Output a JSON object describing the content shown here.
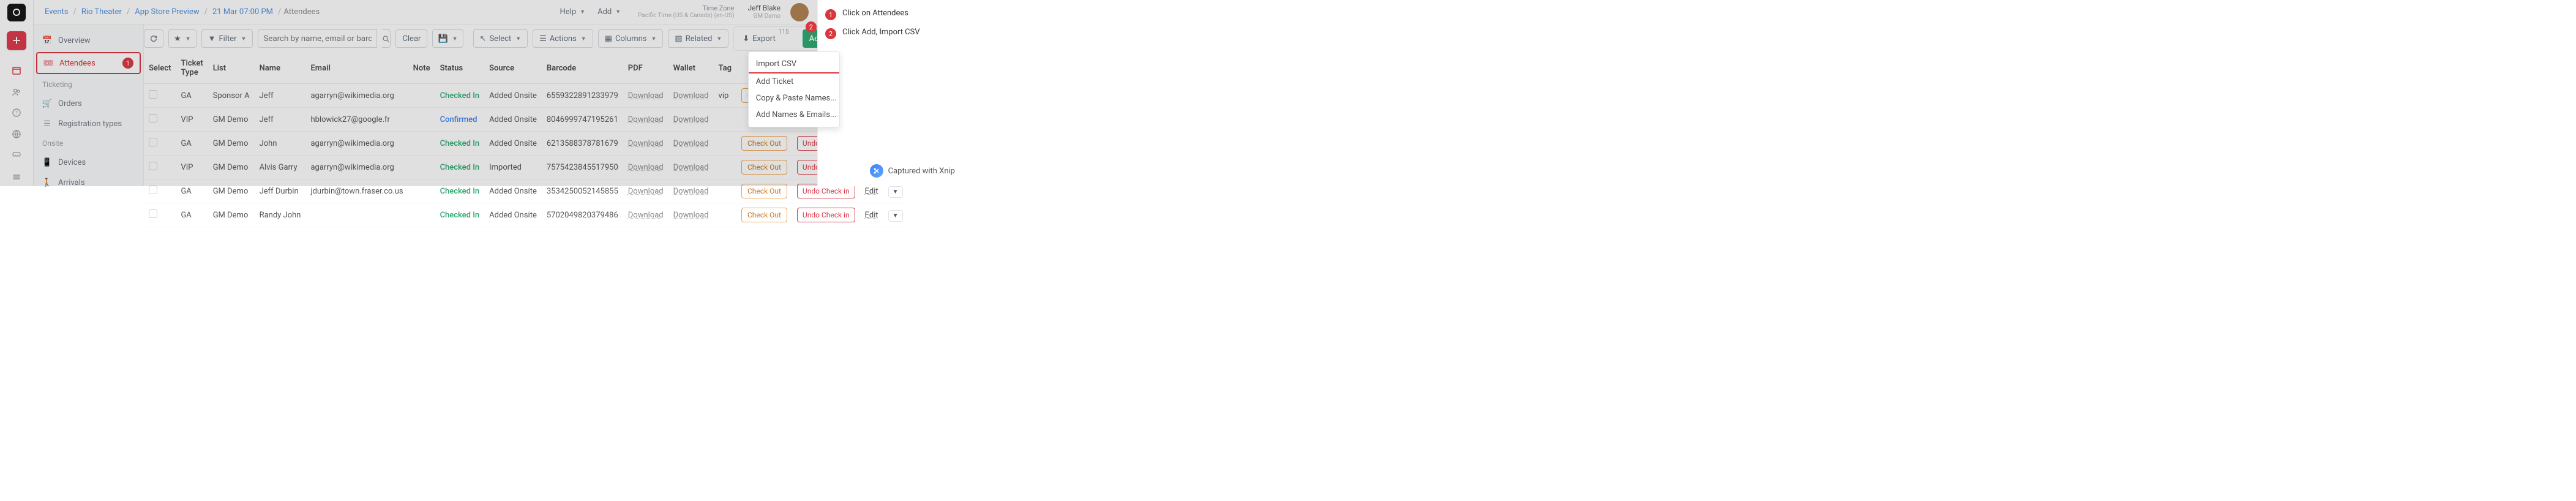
{
  "breadcrumb": [
    "Events",
    "Rio Theater",
    "App Store Preview",
    "21 Mar 07:00 PM",
    "Attendees"
  ],
  "topbar": {
    "help": "Help",
    "add": "Add",
    "timezone_label": "Time Zone",
    "timezone_value": "Pacific Time (US & Canada) (en-US)",
    "user_name": "Jeff Blake",
    "user_role": "GM Demo"
  },
  "sidebar": {
    "overview": "Overview",
    "attendees": "Attendees",
    "ticketing": "Ticketing",
    "orders": "Orders",
    "registration_types": "Registration types",
    "onsite": "Onsite",
    "devices": "Devices",
    "arrivals": "Arrivals",
    "attendees_badge": "1"
  },
  "toolbar": {
    "filter": "Filter",
    "search_placeholder": "Search by name, email or barcode...",
    "clear": "Clear",
    "select": "Select",
    "actions": "Actions",
    "columns": "Columns",
    "related": "Related",
    "export": "Export",
    "export_count": "115",
    "add": "Add",
    "add_badge": "2"
  },
  "dropdown": {
    "import_csv": "Import CSV",
    "add_ticket": "Add Ticket",
    "copy_paste": "Copy & Paste Names...",
    "add_names": "Add Names & Emails..."
  },
  "table": {
    "headers": {
      "select": "Select",
      "ticket_type": "Ticket Type",
      "list": "List",
      "name": "Name",
      "email": "Email",
      "note": "Note",
      "status": "Status",
      "source": "Source",
      "barcode": "Barcode",
      "pdf": "PDF",
      "wallet": "Wallet",
      "tag": "Tag"
    },
    "download": "Download",
    "checkout": "Check Out",
    "undo": "Undo Check in",
    "edit": "Edit",
    "rows": [
      {
        "ticket_type": "GA",
        "list": "Sponsor A",
        "name": "Jeff",
        "email": "agarryn@wikimedia.org",
        "status": "Checked In",
        "status_class": "status-checked",
        "source": "Added Onsite",
        "barcode": "6559322891233979",
        "tag": "vip"
      },
      {
        "ticket_type": "VIP",
        "list": "GM Demo",
        "name": "Jeff",
        "email": "hblowick27@google.fr",
        "status": "Confirmed",
        "status_class": "status-confirmed",
        "source": "Added Onsite",
        "barcode": "8046999747195261",
        "tag": ""
      },
      {
        "ticket_type": "GA",
        "list": "GM Demo",
        "name": "John",
        "email": "agarryn@wikimedia.org",
        "status": "Checked In",
        "status_class": "status-checked",
        "source": "Added Onsite",
        "barcode": "6213588378781679",
        "tag": ""
      },
      {
        "ticket_type": "VIP",
        "list": "GM Demo",
        "name": "Alvis Garry",
        "email": "agarryn@wikimedia.org",
        "status": "Checked In",
        "status_class": "status-checked",
        "source": "Imported",
        "barcode": "7575423845517950",
        "tag": ""
      },
      {
        "ticket_type": "GA",
        "list": "GM Demo",
        "name": "Jeff Durbin",
        "email": "jdurbin@town.fraser.co.us",
        "status": "Checked In",
        "status_class": "status-checked",
        "source": "Added Onsite",
        "barcode": "3534250052145855",
        "tag": ""
      },
      {
        "ticket_type": "GA",
        "list": "GM Demo",
        "name": "Randy John",
        "email": "",
        "status": "Checked In",
        "status_class": "status-checked",
        "source": "Added Onsite",
        "barcode": "5702049820379486",
        "tag": ""
      }
    ]
  },
  "instructions": {
    "step1": {
      "num": "1",
      "text": "Click on Attendees"
    },
    "step2": {
      "num": "2",
      "text": "Click Add, Import CSV"
    }
  },
  "captured": "Captured with Xnip"
}
